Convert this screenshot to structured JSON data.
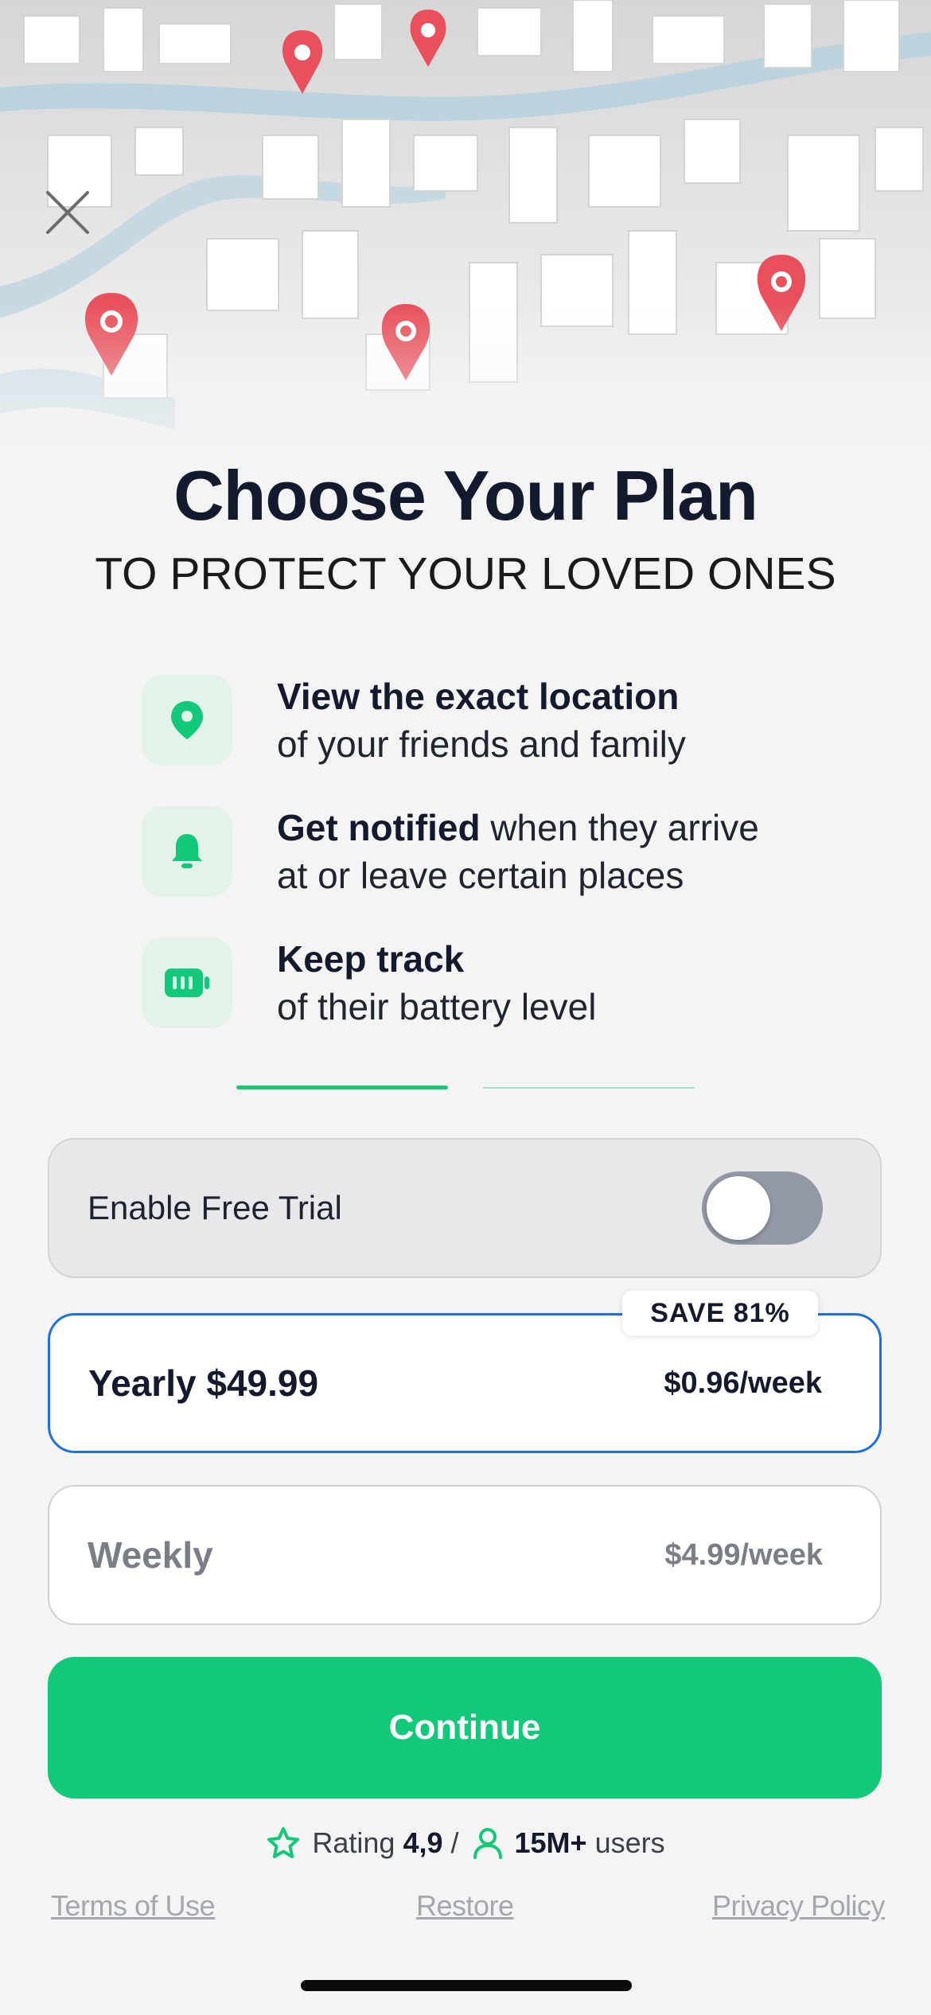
{
  "header": {
    "title": "Choose Your Plan",
    "subtitle": "TO PROTECT YOUR LOVED ONES"
  },
  "features": [
    {
      "icon": "location-pin-icon",
      "bold": "View the exact location",
      "line1_rest": "",
      "line2": "of your friends and family"
    },
    {
      "icon": "bell-icon",
      "bold": "Get notified",
      "line1_rest": " when they arrive",
      "line2": "at or leave certain places"
    },
    {
      "icon": "battery-icon",
      "bold": "Keep track",
      "line1_rest": "",
      "line2": "of their battery level"
    }
  ],
  "pager": {
    "pages": 2,
    "active": 1
  },
  "trial": {
    "label": "Enable Free Trial",
    "enabled": false
  },
  "plans": {
    "yearly": {
      "name": "Yearly $49.99",
      "price": "$0.96/week",
      "badge": "SAVE 81%",
      "selected": true
    },
    "weekly": {
      "name": "Weekly",
      "price": "$4.99/week",
      "selected": false
    }
  },
  "cta": {
    "label": "Continue"
  },
  "rating": {
    "rating_label": "Rating",
    "rating_value": "4,9",
    "separator": "/",
    "users_value": "15M+",
    "users_label": "users"
  },
  "footer": {
    "terms": "Terms of Use",
    "restore": "Restore",
    "privacy": "Privacy Policy"
  },
  "colors": {
    "accent_green": "#12c97a",
    "selected_border": "#1f6fe0",
    "pin_red": "#e8505b"
  }
}
